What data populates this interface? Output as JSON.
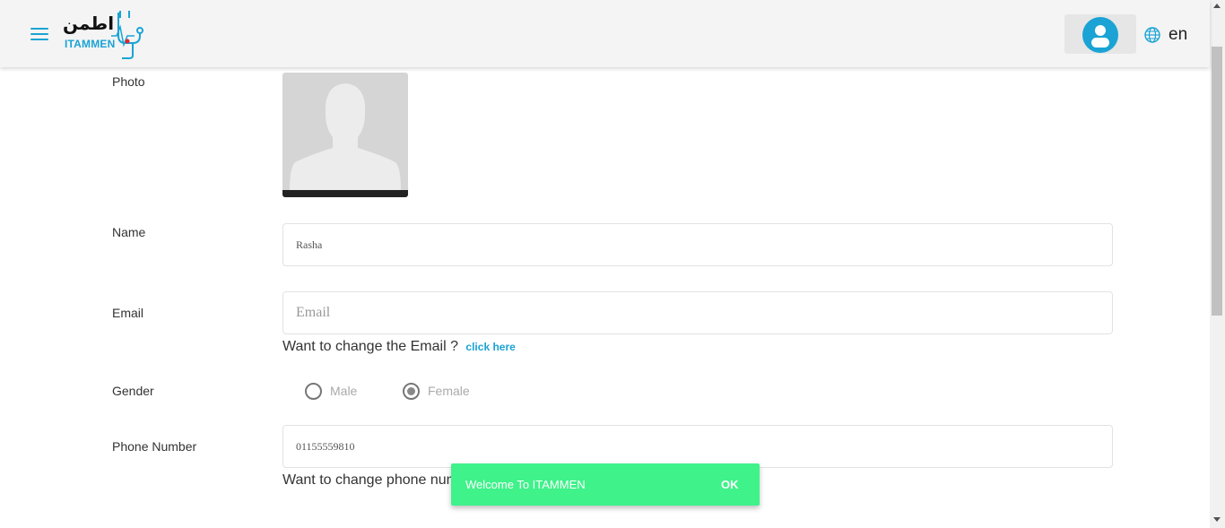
{
  "header": {
    "logo_arabic": "اطمن",
    "logo_text": "ITAMMEN",
    "language": "en"
  },
  "form": {
    "photo_label": "Photo",
    "name_label": "Name",
    "name_value": "Rasha",
    "email_label": "Email",
    "email_placeholder": "Email",
    "email_hint": "Want to change the Email ?",
    "email_hint_link": "click here",
    "gender_label": "Gender",
    "gender_options": [
      "Male",
      "Female"
    ],
    "gender_selected": "Female",
    "phone_label": "Phone Number",
    "phone_value": "01155559810",
    "phone_hint": "Want to change phone num"
  },
  "toast": {
    "message": "Welcome To ITAMMEN",
    "action": "OK"
  },
  "colors": {
    "accent": "#1aa3d4",
    "toast": "#3ff28a"
  }
}
